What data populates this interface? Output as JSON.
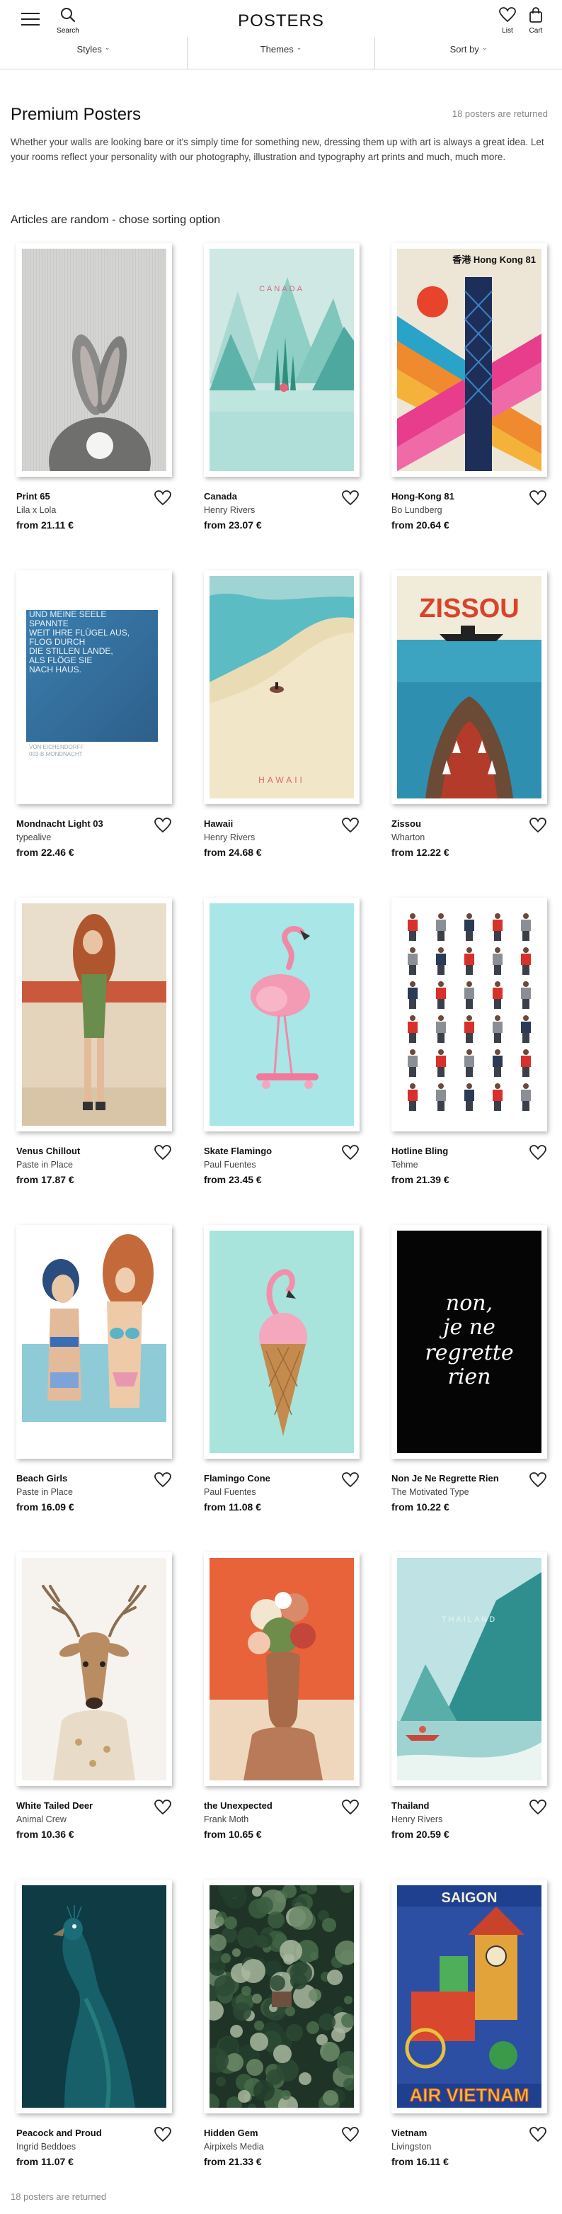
{
  "header": {
    "logo": "POSTERS",
    "search_label": "Search",
    "list_label": "List",
    "cart_label": "Cart"
  },
  "filters": [
    {
      "label": "Styles"
    },
    {
      "label": "Themes"
    },
    {
      "label": "Sort by"
    }
  ],
  "main": {
    "title": "Premium Posters",
    "count_top": "18 posters are returned",
    "intro": "Whether your walls are looking bare or it's simply time for something new, dressing them up with art is always a great idea. Let your rooms reflect your personality with our photography, illustration and typography art prints and much, much more.",
    "sort_note": "Articles are random - chose sorting option",
    "count_bottom": "18 posters are returned"
  },
  "products": [
    {
      "title": "Print 65",
      "artist": "Lila x Lola",
      "price": "from 21.11 €"
    },
    {
      "title": "Canada",
      "artist": "Henry Rivers",
      "price": "from 23.07 €",
      "art_text": "CANADA"
    },
    {
      "title": "Hong-Kong 81",
      "artist": "Bo Lundberg",
      "price": "from 20.64 €",
      "art_text": "香港 Hong Kong 81"
    },
    {
      "title": "Mondnacht Light 03",
      "artist": "typealive",
      "price": "from 22.46 €",
      "art_lines": [
        "UND MEINE SEELE",
        "SPANNTE",
        "WEIT IHRE FLÜGEL AUS,",
        "FLOG DURCH",
        "DIE STILLEN LANDE,",
        "ALS FLÖGE SIE",
        "NACH HAUS."
      ],
      "art_credit": [
        "VON EICHENDORFF",
        "003-B MONDNACHT"
      ]
    },
    {
      "title": "Hawaii",
      "artist": "Henry Rivers",
      "price": "from 24.68 €",
      "art_text": "HAWAII"
    },
    {
      "title": "Zissou",
      "artist": "Wharton",
      "price": "from 12.22 €",
      "art_text": "ZISSOU"
    },
    {
      "title": "Venus Chillout",
      "artist": "Paste in Place",
      "price": "from 17.87 €"
    },
    {
      "title": "Skate Flamingo",
      "artist": "Paul Fuentes",
      "price": "from 23.45 €"
    },
    {
      "title": "Hotline Bling",
      "artist": "Tehme",
      "price": "from 21.39 €"
    },
    {
      "title": "Beach Girls",
      "artist": "Paste in Place",
      "price": "from 16.09 €"
    },
    {
      "title": "Flamingo Cone",
      "artist": "Paul Fuentes",
      "price": "from 11.08 €"
    },
    {
      "title": "Non Je Ne Regrette Rien",
      "artist": "The Motivated Type",
      "price": "from 10.22 €",
      "art_lines": [
        "non,",
        "je ne",
        "regrette",
        "rien"
      ]
    },
    {
      "title": "White Tailed Deer",
      "artist": "Animal Crew",
      "price": "from 10.36 €"
    },
    {
      "title": "the Unexpected",
      "artist": "Frank Moth",
      "price": "from 10.65 €"
    },
    {
      "title": "Thailand",
      "artist": "Henry Rivers",
      "price": "from 20.59 €",
      "art_text": "THAILAND"
    },
    {
      "title": "Peacock and Proud",
      "artist": "Ingrid Beddoes",
      "price": "from 11.07 €"
    },
    {
      "title": "Hidden Gem",
      "artist": "Airpixels Media",
      "price": "from 21.33 €"
    },
    {
      "title": "Vietnam",
      "artist": "Livingston",
      "price": "from 16.11 €",
      "art_text": "SAIGON",
      "art_text2": "AIR VIETNAM"
    }
  ],
  "colors": {
    "text": "#111111",
    "muted": "#888888",
    "divider": "#d5d5d5"
  },
  "icons": {
    "menu": "menu-icon",
    "search": "search-icon",
    "list": "heart-icon",
    "cart": "bag-icon",
    "wishlist": "heart-icon",
    "dropdown": "chevron-down-icon"
  }
}
